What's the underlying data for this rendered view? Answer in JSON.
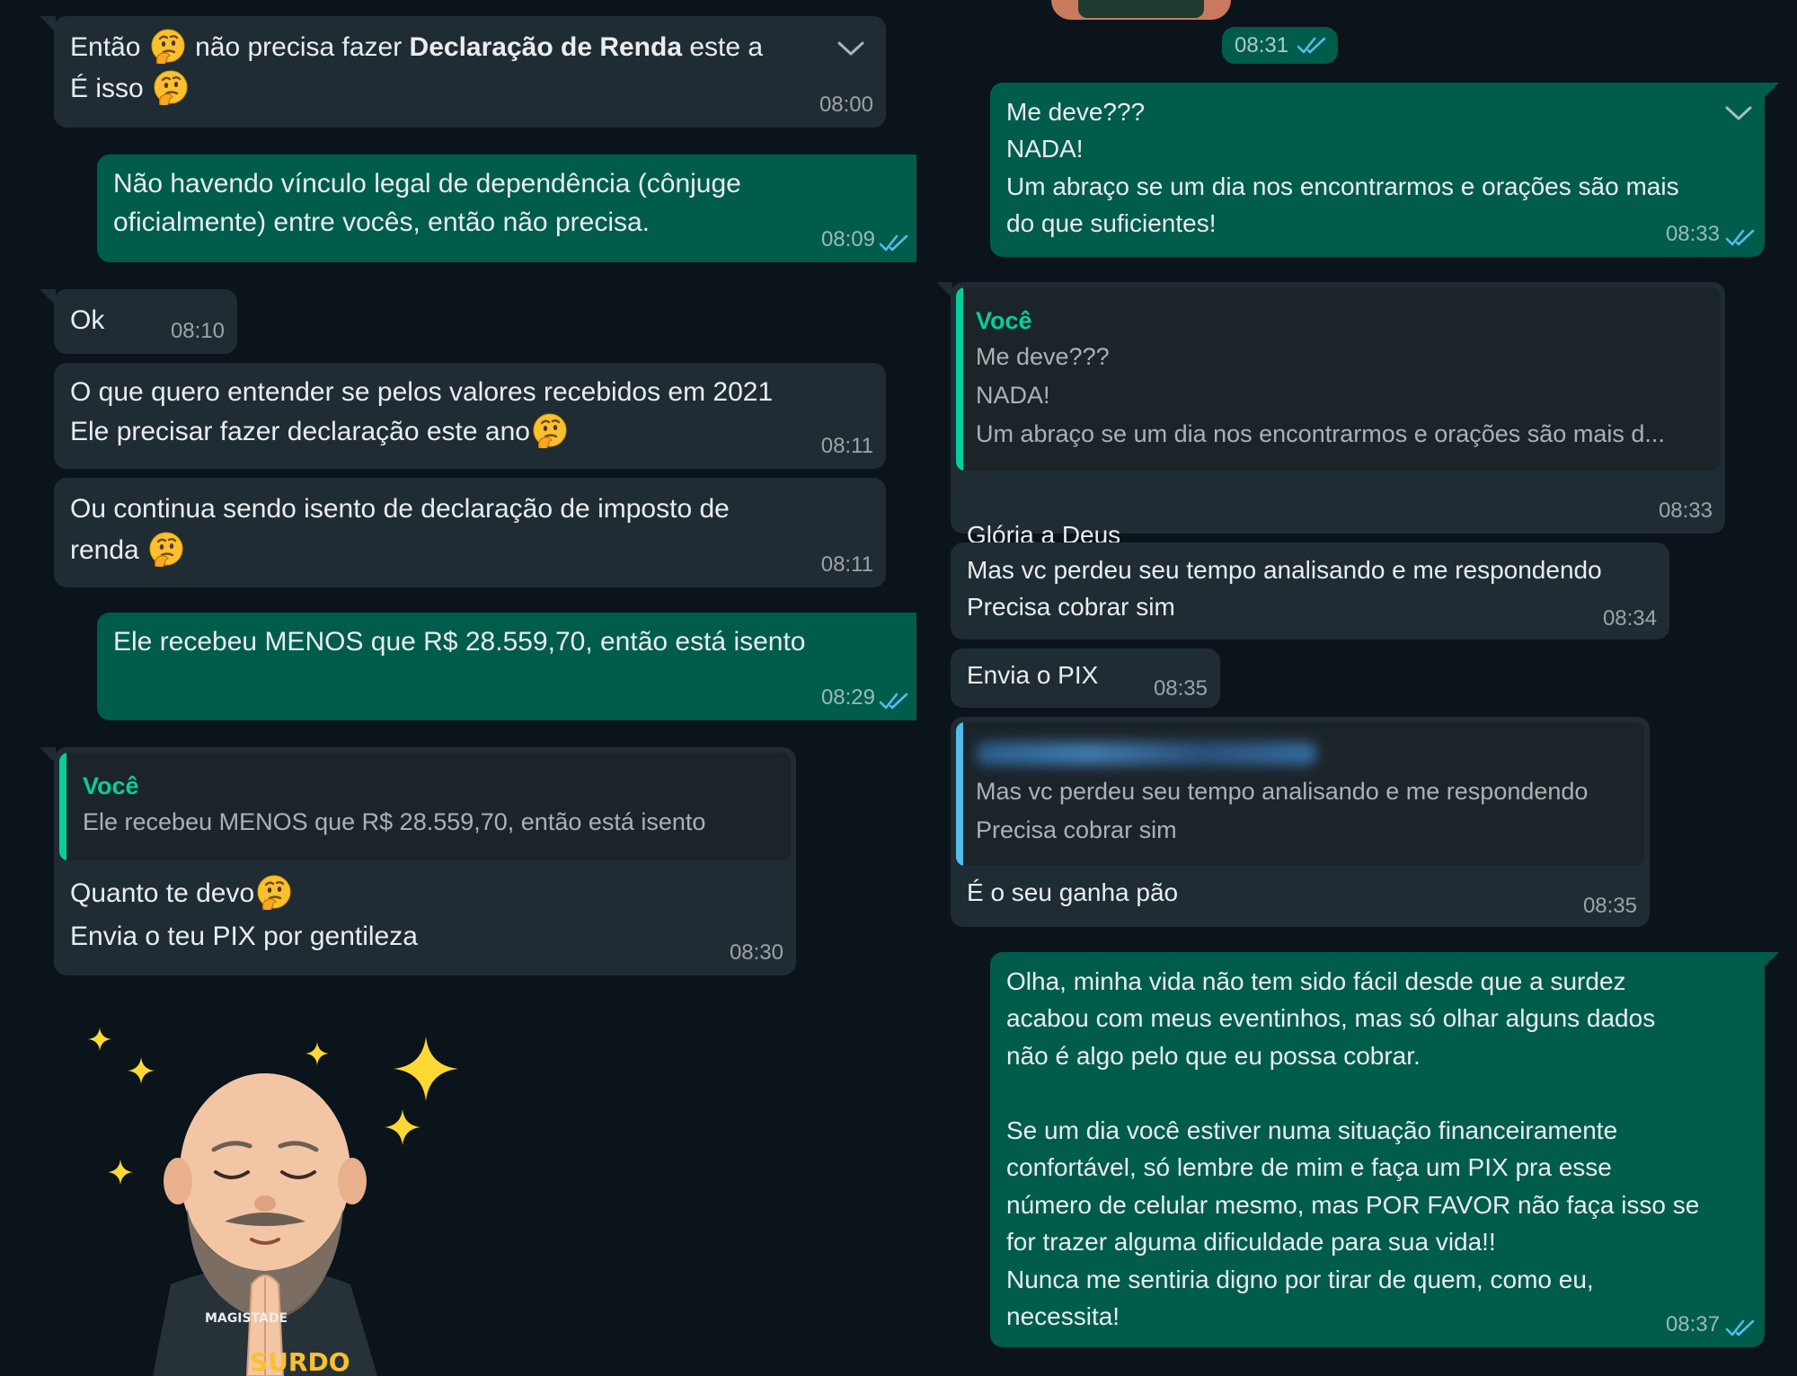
{
  "colors": {
    "background": "#0b141a",
    "incoming_bubble": "#202c33",
    "outgoing_bubble": "#005c4b",
    "read_ticks": "#53bdeb",
    "quote_author_green": "#06cf9c",
    "quote_bar_blue": "#53bdeb"
  },
  "left_column": {
    "m1": {
      "line1_a": "Então",
      "line1_b": " não precisa fazer ",
      "line1_bold": "Declaração de Renda",
      "line1_c": " este a",
      "line2": "É isso",
      "time": "08:00",
      "icons": [
        "thinking-face-icon",
        "chevron-down-icon"
      ]
    },
    "m2": {
      "text": "Não havendo vínculo legal de dependência (cônjuge\noficialmente) entre vocês, então não precisa.",
      "time": "08:09",
      "status": "read"
    },
    "m3": {
      "text": "Ok",
      "time": "08:10"
    },
    "m4": {
      "line1": "O que quero entender se pelos valores recebidos em 2021",
      "line2": "Ele precisar fazer declaração este ano",
      "time": "08:11"
    },
    "m5": {
      "line1": "Ou continua sendo isento de declaração de imposto de",
      "line2": "renda",
      "time": "08:11"
    },
    "m6": {
      "text": "Ele recebeu MENOS que R$ 28.559,70, então está isento",
      "time": "08:29",
      "status": "read"
    },
    "m7": {
      "quote_author": "Você",
      "quote_text": "Ele recebeu MENOS que R$ 28.559,70, então está isento",
      "line1": "Quanto te devo",
      "line2": "Envia o teu PIX por gentileza",
      "time": "08:30"
    },
    "sticker": {
      "icon": "praying-avatar-sticker-icon",
      "shirt_text_1": "MAGISTADE",
      "shirt_text_2": "SURDO"
    }
  },
  "right_column": {
    "top_time": "08:31",
    "r1": {
      "text": "Me deve???\nNADA!\nUm abraço se um dia nos encontrarmos e orações são mais\ndo que suficientes!",
      "time": "08:33",
      "status": "read"
    },
    "r2": {
      "quote_author": "Você",
      "quote_text": "Me deve???\nNADA!\nUm abraço se um dia nos encontrarmos e orações são mais d...",
      "text": "Glória a Deus",
      "emoji": "🙌🙌🙌",
      "time": "08:33"
    },
    "r3": {
      "text": "Mas vc perdeu seu tempo analisando e me respondendo\nPrecisa cobrar sim",
      "time": "08:34"
    },
    "r4": {
      "text": "Envia o PIX",
      "time": "08:35"
    },
    "r5": {
      "quote_text": "Mas vc perdeu seu tempo analisando e me respondendo\nPrecisa cobrar sim",
      "text": "É o seu ganha pão",
      "time": "08:35"
    },
    "r6": {
      "text": "Olha, minha vida não tem sido fácil desde que a surdez\nacabou com meus eventinhos, mas só olhar alguns dados\nnão é algo pelo que eu possa cobrar.\n\nSe um dia você estiver numa situação financeiramente\nconfortável, só lembre de mim e faça um PIX pra esse\nnúmero de celular mesmo, mas POR FAVOR não faça isso se\nfor trazer alguma dificuldade para sua vida!!\nNunca me sentiria digno por tirar de quem, como eu,\nnecessita!",
      "time": "08:37",
      "status": "read"
    }
  }
}
